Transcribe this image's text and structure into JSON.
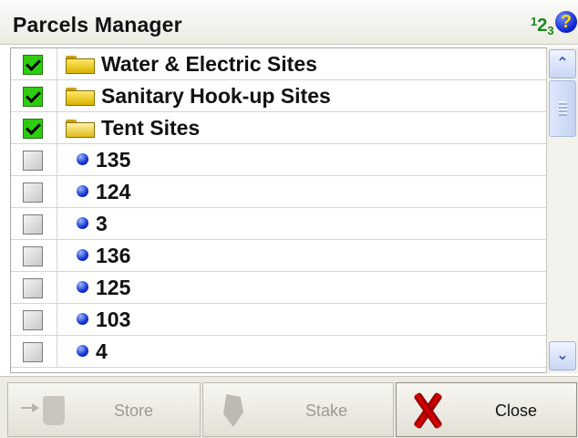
{
  "window": {
    "title": "Parcels Manager",
    "numpad_icon_text": {
      "one": "1",
      "two": "2",
      "three": "3"
    },
    "help_icon_text": "?"
  },
  "list": {
    "rows": [
      {
        "type": "folder",
        "checked": true,
        "label": "Water & Electric Sites",
        "icon": "folder-closed-icon"
      },
      {
        "type": "folder",
        "checked": true,
        "label": "Sanitary Hook-up Sites",
        "icon": "folder-closed-icon"
      },
      {
        "type": "folder",
        "checked": true,
        "label": "Tent Sites",
        "icon": "folder-open-icon"
      },
      {
        "type": "parcel",
        "checked": false,
        "label": "135",
        "icon": "blue-dot-icon"
      },
      {
        "type": "parcel",
        "checked": false,
        "label": "124",
        "icon": "blue-dot-icon"
      },
      {
        "type": "parcel",
        "checked": false,
        "label": "3",
        "icon": "blue-dot-icon"
      },
      {
        "type": "parcel",
        "checked": false,
        "label": "136",
        "icon": "blue-dot-icon"
      },
      {
        "type": "parcel",
        "checked": false,
        "label": "125",
        "icon": "blue-dot-icon"
      },
      {
        "type": "parcel",
        "checked": false,
        "label": "103",
        "icon": "blue-dot-icon"
      },
      {
        "type": "parcel",
        "checked": false,
        "label": "4",
        "icon": "blue-dot-icon"
      }
    ]
  },
  "toolbar": {
    "store_label": "Store",
    "stake_label": "Stake",
    "close_label": "Close",
    "store_enabled": false,
    "stake_enabled": false,
    "close_enabled": true
  },
  "colors": {
    "check_on": "#2ecc10",
    "accent_blue": "#1030d0",
    "close_red": "#e10000"
  }
}
